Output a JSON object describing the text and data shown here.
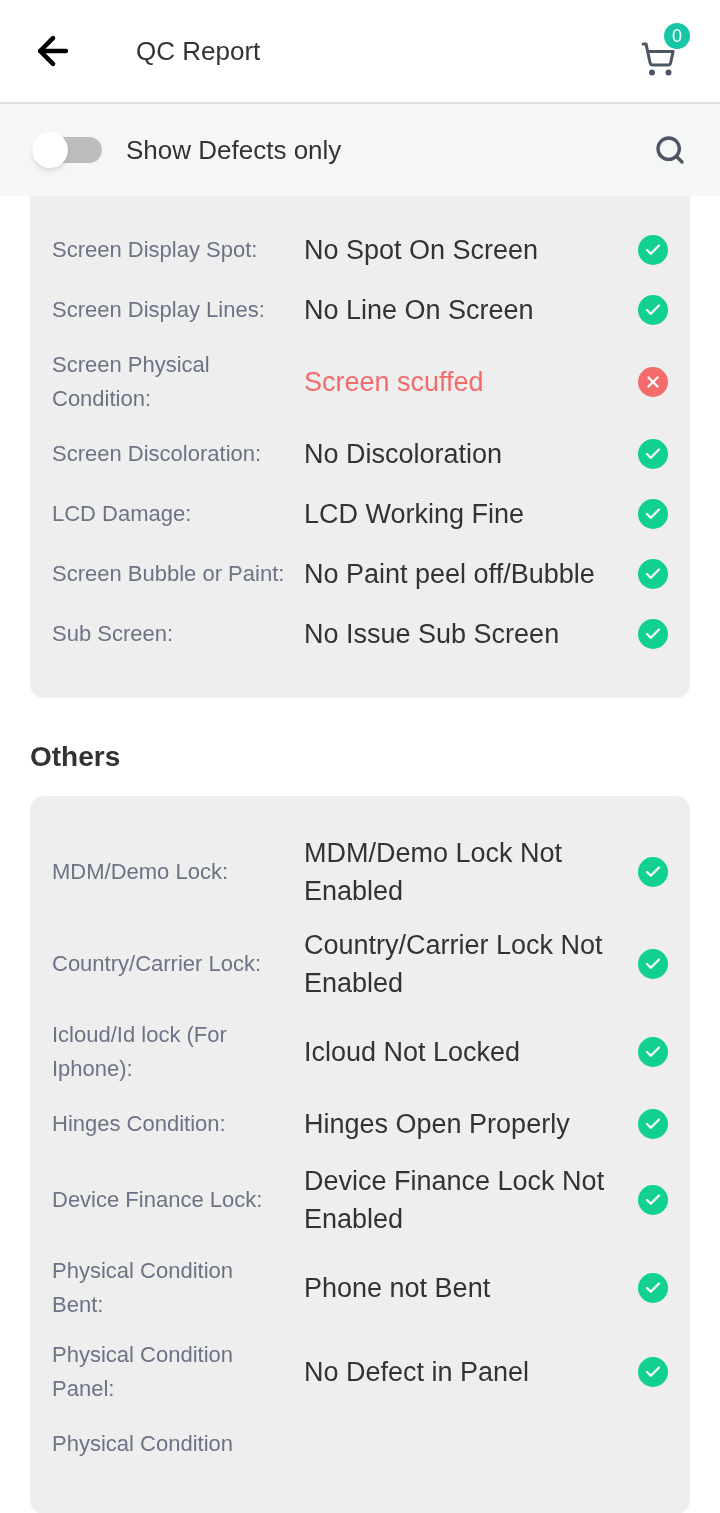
{
  "header": {
    "title": "QC Report",
    "cart_count": "0"
  },
  "filter": {
    "label": "Show Defects only",
    "on": false
  },
  "sections": [
    {
      "items": [
        {
          "label": "Screen Display Spot:",
          "value": "No Spot On Screen",
          "defect": false,
          "kind": "row"
        },
        {
          "label": "Screen Display Lines:",
          "value": "No Line On Screen",
          "defect": false,
          "kind": "row"
        },
        {
          "label": "Screen Physical Condition:",
          "value": "Screen scuffed",
          "defect": true,
          "kind": "row"
        },
        {
          "label": "Screen Discoloration:",
          "value": "No Discoloration",
          "defect": false,
          "kind": "row"
        },
        {
          "label": "LCD Damage:",
          "value": "LCD Working Fine",
          "defect": false,
          "kind": "row"
        },
        {
          "label": "Screen Bubble or Paint:",
          "value": "No Paint peel off/Bubble",
          "defect": false,
          "kind": "row"
        },
        {
          "label": "Sub Screen:",
          "value": "No Issue Sub Screen",
          "defect": false,
          "kind": "row"
        }
      ]
    },
    {
      "heading": "Others",
      "items": [
        {
          "label": "MDM/Demo Lock:",
          "value": "MDM/Demo Lock Not Enabled",
          "defect": false,
          "kind": "row"
        },
        {
          "label": "Country/Carrier Lock:",
          "value": "Country/Carrier Lock Not Enabled",
          "defect": false,
          "kind": "row"
        },
        {
          "label": "Icloud/Id lock (For Iphone):",
          "value": "Icloud Not Locked",
          "defect": false,
          "kind": "row"
        },
        {
          "label": "Hinges Condition:",
          "value": "Hinges Open Properly",
          "defect": false,
          "kind": "row"
        },
        {
          "label": "Device Finance Lock:",
          "value": "Device Finance Lock Not Enabled",
          "defect": false,
          "kind": "row"
        },
        {
          "label": "Physical Condition Bent:",
          "value": "Phone not Bent",
          "defect": false,
          "kind": "row"
        },
        {
          "label": "Physical Condition Panel:",
          "value": "No Defect in Panel",
          "defect": false,
          "kind": "row"
        },
        {
          "label": "Physical Condition",
          "kind": "row"
        }
      ]
    }
  ]
}
